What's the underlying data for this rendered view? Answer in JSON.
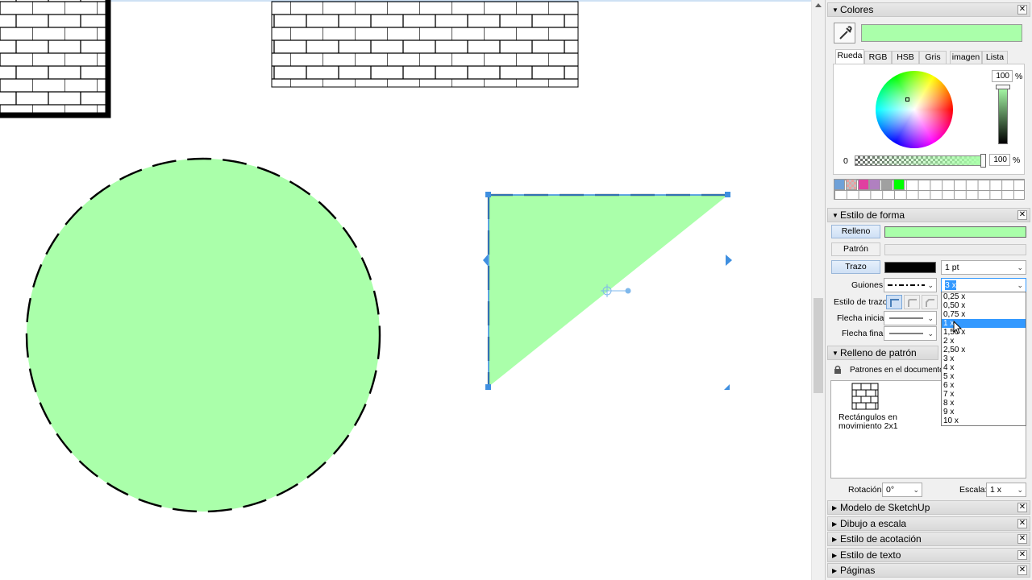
{
  "canvas": {
    "shapes": [
      "brick-pattern-square",
      "brick-pattern-wide",
      "dashed-circle",
      "selected-triangle"
    ]
  },
  "colors_panel": {
    "title": "Colores",
    "current_color": "#aaffaa",
    "tabs": [
      "Rueda",
      "RGB",
      "HSB",
      "Gris",
      "imagen",
      "Lista"
    ],
    "active_tab": "Rueda",
    "brightness_value": "100",
    "brightness_unit": "%",
    "opacity_min": "0",
    "opacity_value": "100",
    "opacity_unit": "%",
    "swatches": [
      "#6fa1d8",
      "#c0c0c0",
      "#e040a0",
      "#b080c0",
      "#a0a0a0",
      "#a09880",
      "#00ff00"
    ]
  },
  "shape_style": {
    "title": "Estilo de forma",
    "fill_label": "Relleno",
    "fill_color": "#aaffaa",
    "pattern_label": "Patrón",
    "stroke_label": "Trazo",
    "stroke_color": "#000000",
    "stroke_width": "1 pt",
    "dashes_label": "Guiones:",
    "dash_scale": "3 x",
    "stroke_style_label": "Estilo de trazo:",
    "start_arrow_label": "Flecha inicial:",
    "end_arrow_label": "Flecha final:",
    "dash_scale_options": [
      "0,25 x",
      "0,50 x",
      "0,75 x",
      "1 x",
      "1,50 x",
      "2 x",
      "2,50 x",
      "3 x",
      "4 x",
      "5 x",
      "6 x",
      "7 x",
      "8 x",
      "9 x",
      "10 x"
    ],
    "highlighted_option": "1 x"
  },
  "pattern_fill": {
    "title": "Relleno de patrón",
    "collection": "Patrones en el documento",
    "pattern_name_line1": "Rectángulos en",
    "pattern_name_line2": "movimiento 2x1",
    "rotation_label": "Rotación:",
    "rotation_value": "0°",
    "scale_label": "Escala:",
    "scale_value": "1 x"
  },
  "collapsed_sections": [
    "Modelo de SketchUp",
    "Dibujo a escala",
    "Estilo de acotación",
    "Estilo de texto",
    "Páginas"
  ]
}
